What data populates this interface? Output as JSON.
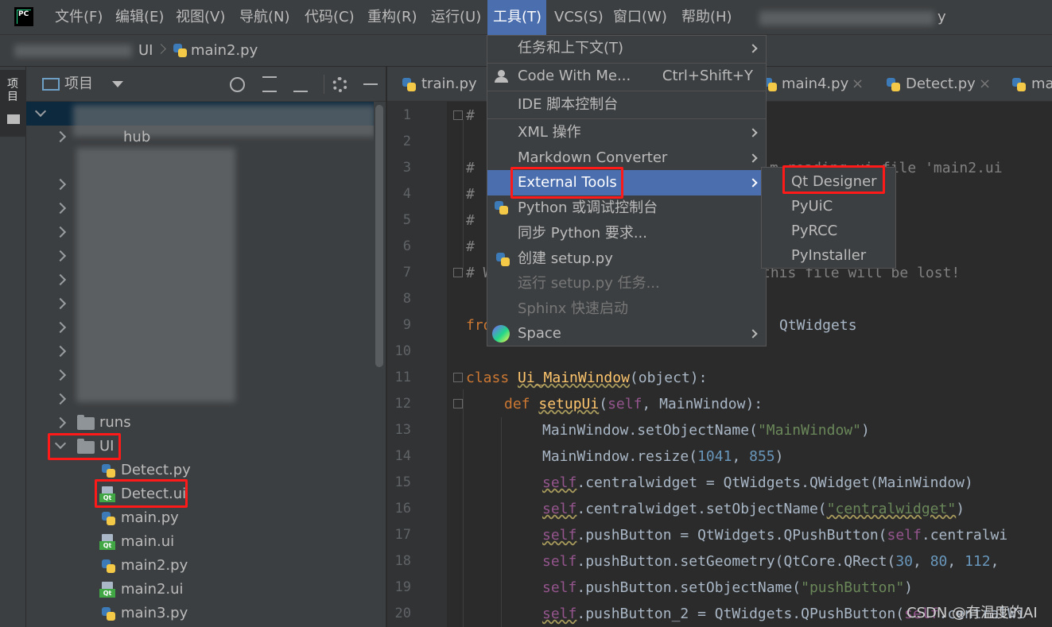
{
  "menubar": {
    "logo_text": "PC",
    "items": [
      "文件(F)",
      "编辑(E)",
      "视图(V)",
      "导航(N)",
      "代码(C)",
      "重构(R)",
      "运行(U)",
      "工具(T)",
      "VCS(S)",
      "窗口(W)",
      "帮助(H)"
    ],
    "active_index": 7,
    "title_tail": "y"
  },
  "navbar": {
    "crumb": "UI",
    "file": "main2.py"
  },
  "leftstrip": {
    "project_tab": "项目"
  },
  "project_panel": {
    "title": "项目",
    "dropdown_icon": "chevron-down-icon",
    "toolbar_icons": [
      "locate-icon",
      "expand-all-icon",
      "collapse-all-icon",
      "gear-icon",
      "minimize-icon"
    ],
    "partial_label": "hub",
    "runs_folder": "runs",
    "ui_folder": "UI",
    "ui_files": [
      "Detect.py",
      "Detect.ui",
      "main.py",
      "main.ui",
      "main2.py",
      "main2.ui",
      "main3.py"
    ]
  },
  "editor_tabs": [
    "train.py",
    "main4.py",
    "Detect.py",
    "ma"
  ],
  "line_numbers": [
    "1",
    "2",
    "3",
    "4",
    "5",
    "6",
    "7",
    "8",
    "9",
    "10",
    "11",
    "12",
    "13",
    "14",
    "15",
    "16",
    "17",
    "18",
    "19",
    "20"
  ],
  "code": {
    "l1": "#",
    "l3a": "# ",
    "l3b": "m reading ui file 'main2.ui",
    "l4": "#",
    "l5": "# ",
    "l6": "#",
    "l7a": "# W",
    "l7b": "this file will be lost!",
    "l9a": "fro",
    "l9b": "QtWidgets",
    "l11_kw": "class",
    "l11_name": "Ui_MainWindow",
    "l11_rest": "(object):",
    "l12_kw": "def",
    "l12_fn": "setupUi",
    "l12_self": "self",
    "l12_rest": ", MainWindow):",
    "l13a": "MainWindow.setObjectName(",
    "l13s": "\"MainWindow\"",
    "l13b": ")",
    "l14a": "MainWindow.resize(",
    "l14n1": "1041",
    "l14c": ", ",
    "l14n2": "855",
    "l14b": ")",
    "l15s": "self",
    "l15a": ".centralwidget = QtWidgets.QWidget(MainWindow)",
    "l16s": "self",
    "l16a": ".centralwidget.setObjectName(",
    "l16str": "\"centralwidget\"",
    "l16b": ")",
    "l17s": "self",
    "l17a": ".pushButton = QtWidgets.QPushButton(",
    "l17s2": "self",
    "l17b": ".centralwi",
    "l18s": "self",
    "l18a": ".pushButton.setGeometry(QtCore.QRect(",
    "l18n1": "30",
    "l18c1": ", ",
    "l18n2": "80",
    "l18c2": ", ",
    "l18n3": "112",
    "l18c3": ",",
    "l19s": "self",
    "l19a": ".pushButton.setObjectName(",
    "l19str": "\"pushButton\"",
    "l19b": ")",
    "l20s": "self",
    "l20a": ".pushButton_2 = QtWidgets.QPushButton(",
    "l20s2": "self",
    "l20b": ".centralWi"
  },
  "tools_menu": {
    "items": [
      {
        "label": "任务和上下文(T)",
        "submenu": true
      },
      {
        "label": "Code With Me...",
        "shortcut": "Ctrl+Shift+Y"
      },
      {
        "label": "IDE 脚本控制台"
      },
      {
        "label": "XML 操作",
        "submenu": true
      },
      {
        "label": "Markdown Converter",
        "submenu": true
      },
      {
        "label": "External Tools",
        "submenu": true,
        "highlighted": true
      },
      {
        "label": "Python 或调试控制台"
      },
      {
        "label": "同步 Python 要求..."
      },
      {
        "label": "创建 setup.py"
      },
      {
        "label": "运行 setup.py 任务...",
        "disabled": true
      },
      {
        "label": "Sphinx 快速启动",
        "disabled": true
      },
      {
        "label": "Space",
        "submenu": true
      }
    ]
  },
  "external_tools_menu": {
    "items": [
      "Qt Designer",
      "PyUiC",
      "PyRCC",
      "PyInstaller"
    ]
  },
  "watermark": "CSDN @有温度的AI",
  "colors": {
    "highlight": "#4b6eaf",
    "annotation_red": "#ff1a1a",
    "background": "#2b2b2b",
    "panel": "#3c3f41"
  }
}
